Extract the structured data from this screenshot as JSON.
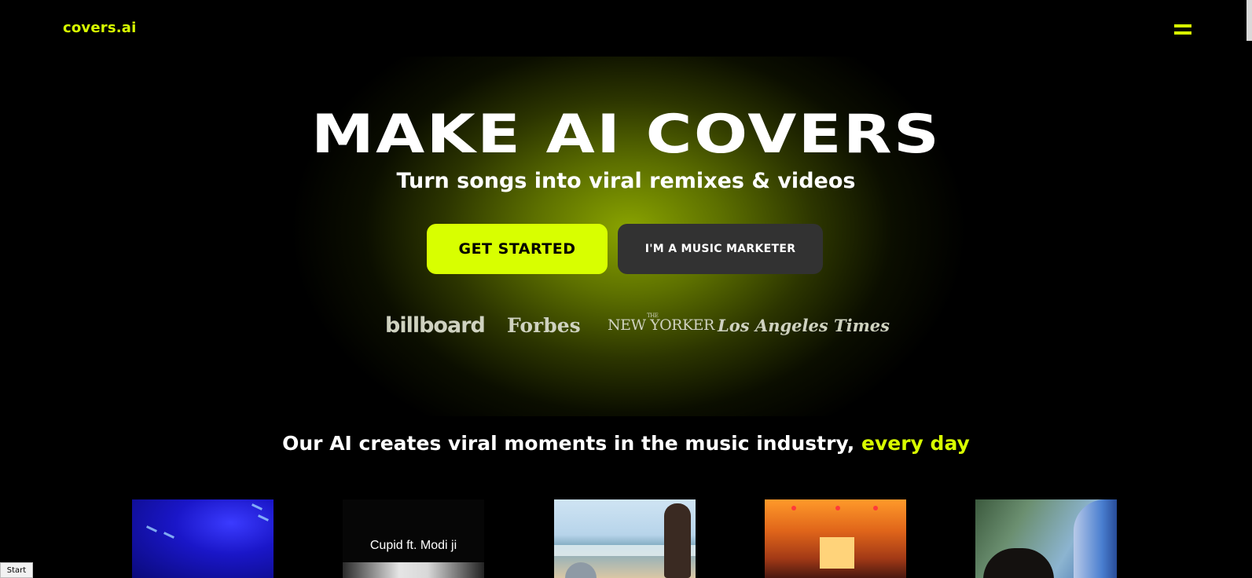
{
  "header": {
    "logo_text": "covers.ai",
    "menu_icon": "hamburger-menu-icon",
    "accent_color": "#d8ff00"
  },
  "hero": {
    "title": "MAKE AI COVERS",
    "subtitle": "Turn songs into viral remixes & videos",
    "primary_button_label": "GET STARTED",
    "secondary_button_label": "I'M A MUSIC MARKETER",
    "press_logos": [
      {
        "name": "billboard",
        "text": "billboard"
      },
      {
        "name": "forbes",
        "text": "Forbes"
      },
      {
        "name": "new-yorker",
        "text": "NEW YORKER",
        "prefix": "THE"
      },
      {
        "name": "los-angeles-times",
        "text": "Los Angeles Times"
      }
    ]
  },
  "tagline": {
    "text": "Our AI creates viral moments in the music industry, ",
    "accent_text": "every day"
  },
  "videos": [
    {
      "caption": ""
    },
    {
      "caption": "Cupid ft. Modi ji"
    },
    {
      "caption": ""
    },
    {
      "caption": ""
    },
    {
      "caption": ""
    }
  ],
  "status": {
    "label": "Start"
  }
}
